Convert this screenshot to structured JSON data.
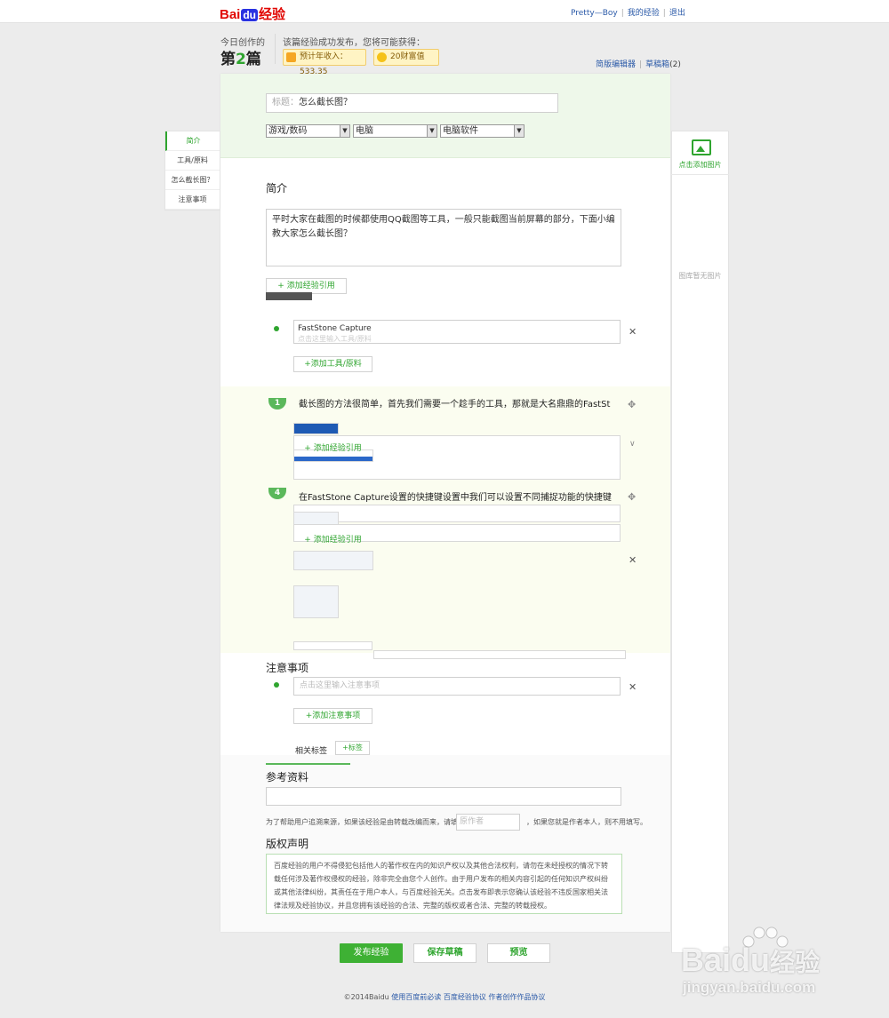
{
  "topbar": {
    "logo_bai": "Bai",
    "logo_du": "du",
    "logo_jingyan": "经验",
    "username": "Pretty—Boy",
    "my_experience": "我的经验",
    "logout": "退出"
  },
  "stats": {
    "today_label": "今日创作的",
    "today_prefix": "第",
    "today_num": "2",
    "today_suffix": "篇",
    "reward_label": "该篇经验成功发布，您将可能获得：",
    "income": "预计年收入：533.35",
    "wealth": "20财富值",
    "simple_editor": "简版编辑器",
    "drafts_label": "草稿箱",
    "drafts_count": "(2)"
  },
  "form": {
    "title_placeholder": "标题：",
    "title_value": "怎么截长图？",
    "cat1": "游戏/数码",
    "cat2": "电脑",
    "cat3": "电脑软件"
  },
  "side_nav": {
    "items": [
      "简介",
      "工具/原料",
      "怎么截长图？",
      "注意事项"
    ]
  },
  "right_panel": {
    "add_image": "点击添加图片",
    "no_image": "图库暂无图片"
  },
  "intro": {
    "heading": "简介",
    "text": "平时大家在截图的时候都使用QQ截图等工具，一般只能截图当前屏幕的部分，下面小编教大家怎么截长图？",
    "add_ref": "+ 添加经验引用"
  },
  "tools": {
    "value": "FastStone Capture",
    "ghost": "点击这里输入工具/原料",
    "add_tool": "+添加工具/原料"
  },
  "steps": {
    "step1_num": "1",
    "step1_text": "截长图的方法很简单，首先我们需要一个趁手的工具，那就是大名鼎鼎的FastSt",
    "step1_add_ref": "+ 添加经验引用",
    "step4_num": "4",
    "step4_text": "在FastStone Capture设置的快捷键设置中我们可以设置不同捕捉功能的快捷键",
    "step4_add_ref": "+ 添加经验引用"
  },
  "notes": {
    "heading": "注意事项",
    "placeholder": "点击这里输入注意事项",
    "add_note": "+添加注意事项"
  },
  "tags": {
    "label": "相关标签",
    "add_tag": "+标签"
  },
  "reference": {
    "heading": "参考资料",
    "note_before": "为了帮助用户追溯来源，如果该经验是由转载改编而来，请填写",
    "author_placeholder": "原作者",
    "note_after": "，如果您就是作者本人，则不用填写。"
  },
  "copyright": {
    "heading": "版权声明",
    "text": "百度经验的用户不得侵犯包括他人的著作权在内的知识产权以及其他合法权利，请勿在未经授权的情况下转载任何涉及著作权侵权的经验，除非完全由您个人创作。由于用户发布的相关内容引起的任何知识产权纠纷或其他法律纠纷，其责任在于用户本人，与百度经验无关。点击发布即表示您确认该经验不违反国家相关法律法规及经验协议，并且您拥有该经验的合法、完整的版权或者合法、完整的转载授权。"
  },
  "actions": {
    "publish": "发布经验",
    "save_draft": "保存草稿",
    "preview": "预览"
  },
  "footer": {
    "copyright": "©2014Baidu",
    "link1": "使用百度前必读",
    "link2": "百度经验协议",
    "link3": "作者创作作品协议"
  },
  "watermark": {
    "brand_bai": "Bai",
    "brand_du": "du",
    "brand_jingyan": "经验",
    "url": "jingyan.baidu.com"
  },
  "colors": {
    "accent": "#3eb134",
    "link": "#2b5aa8",
    "logo_red": "#e10602"
  }
}
